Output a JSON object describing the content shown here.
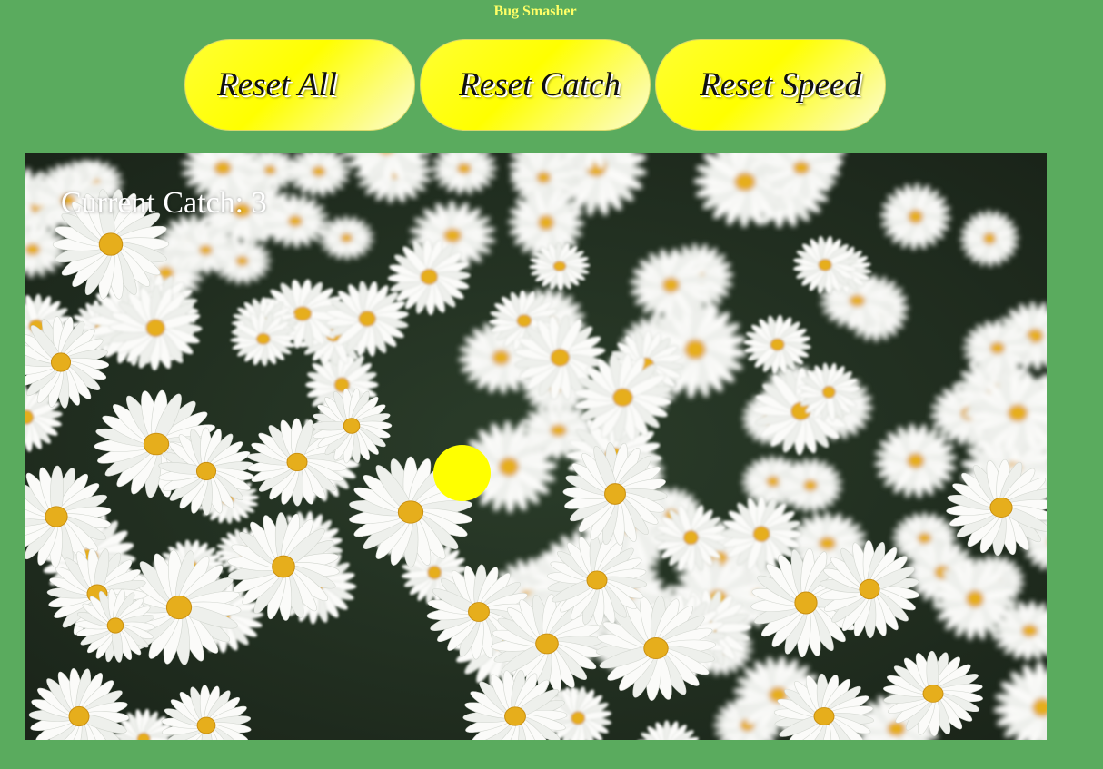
{
  "header": {
    "title": "Bug Smasher"
  },
  "buttons": {
    "reset_all": "Reset All",
    "reset_catch": "Reset Catch",
    "reset_speed": "Reset Speed"
  },
  "game": {
    "catch_label": "Current Catch: 3",
    "background_image": "daisy-field",
    "bug_color": "#ffff00"
  },
  "colors": {
    "page_background": "#5aab5e",
    "title_color": "#ffff66",
    "button_fill": "#ffff00"
  }
}
